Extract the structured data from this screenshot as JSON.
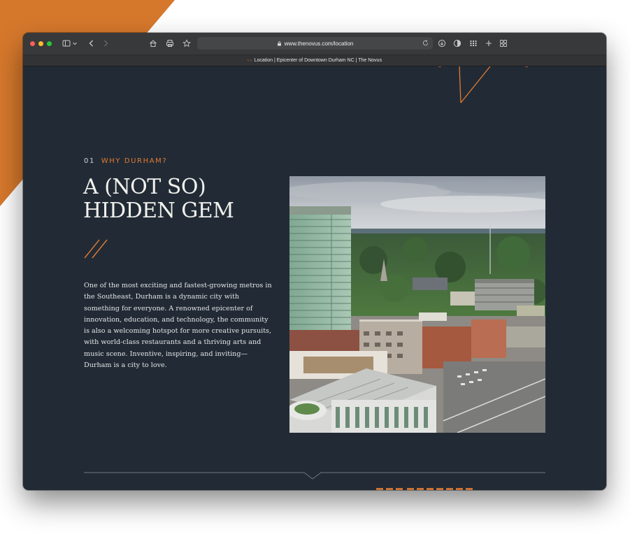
{
  "browser": {
    "url": "www.thenovus.com/location",
    "tab_title": "Location | Epicenter of Downtown Durham NC | The Novus",
    "icons": [
      "sidebar-icon",
      "chevron-down-icon",
      "back-icon",
      "forward-icon",
      "home-icon",
      "print-icon",
      "star-icon",
      "lock-icon",
      "reload-icon",
      "download-icon",
      "shield-icon",
      "grid-icon",
      "plus-icon",
      "tabs-overview-icon",
      "speaker-icon"
    ]
  },
  "section": {
    "number": "01",
    "kicker": "WHY DURHAM?",
    "headline_line1": "A (NOT SO)",
    "headline_line2": "HIDDEN GEM",
    "body": "One of the most exciting and fastest-growing metros in the Southeast, Durham is a dynamic city with something for everyone. A renowned epicenter of innovation, education, and technology, the community is also a welcoming hotspot for more creative pursuits, with world-class restaurants and a thriving arts and music scene. Inventive, inspiring, and inviting—Durham is a city to love."
  },
  "colors": {
    "accent": "#e07a34",
    "page_bg": "#222b35",
    "text": "#e3e5e6"
  }
}
